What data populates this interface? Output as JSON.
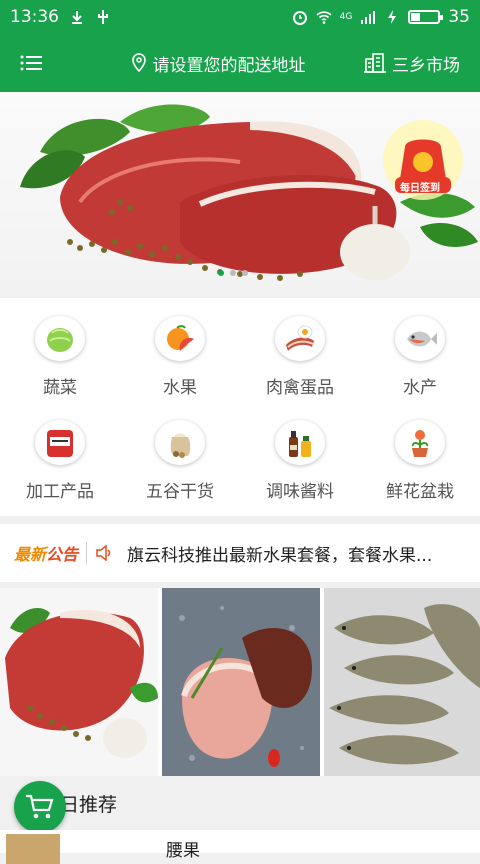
{
  "status_bar": {
    "time": "13:36",
    "network": "4G",
    "battery": "35",
    "battery_level": 0.35
  },
  "header": {
    "address": "请设置您的配送地址",
    "market": "三乡市场"
  },
  "banner": {
    "checkin_label": "每日签到"
  },
  "categories": [
    {
      "label": "蔬菜",
      "icon": "lettuce-icon"
    },
    {
      "label": "水果",
      "icon": "orange-icon"
    },
    {
      "label": "肉禽蛋品",
      "icon": "meat-egg-icon"
    },
    {
      "label": "水产",
      "icon": "fish-icon"
    },
    {
      "label": "加工产品",
      "icon": "processed-food-icon"
    },
    {
      "label": "五谷干货",
      "icon": "grain-sack-icon"
    },
    {
      "label": "调味酱料",
      "icon": "condiment-bottles-icon"
    },
    {
      "label": "鲜花盆栽",
      "icon": "flower-pot-icon"
    }
  ],
  "notice": {
    "tag_a": "最新",
    "tag_b": "公告",
    "text": "旗云科技推出最新水果套餐，套餐水果..."
  },
  "recommend": {
    "title": "日推荐"
  },
  "items": [
    {
      "name": "腰果"
    }
  ],
  "colors": {
    "brand_green": "#17a24b",
    "notice_orange": "#f08a00"
  }
}
